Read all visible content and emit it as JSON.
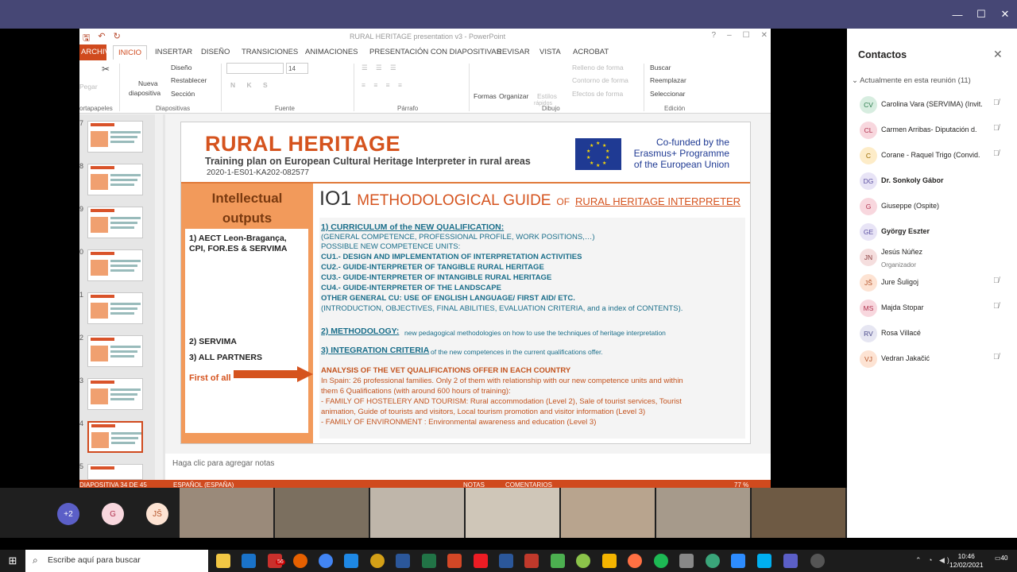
{
  "ppt": {
    "doc_title": "RURAL HERITAGE presentation v3 - PowerPoint",
    "tabs": [
      "ARCHIVO",
      "INICIO",
      "INSERTAR",
      "DISEÑO",
      "TRANSICIONES",
      "ANIMACIONES",
      "PRESENTACIÓN CON DIAPOSITIVAS",
      "REVISAR",
      "VISTA",
      "ACROBAT"
    ],
    "ribbon": {
      "pegar": "Pegar",
      "nueva": "Nueva",
      "diapositiva": "diapositiva",
      "diseno": "Diseño",
      "restablecer": "Restablecer",
      "seccion": "Sección",
      "font_size": "14",
      "formas": "Formas",
      "organizar": "Organizar",
      "estilos": "Estilos",
      "rapidos": "rápidos",
      "relleno": "Relleno de forma",
      "contorno": "Contorno de forma",
      "efectos": "Efectos de forma",
      "buscar": "Buscar",
      "reemplazar": "Reemplazar",
      "seleccionar": "Seleccionar",
      "groups": [
        "ortapapeles",
        "Diapositivas",
        "Fuente",
        "Párrafo",
        "Dibujo",
        "Edición"
      ]
    },
    "thumb_numbers": [
      "7",
      "8",
      "9",
      "0",
      "1",
      "2",
      "3",
      "4",
      "5"
    ],
    "notes_placeholder": "Haga clic para agregar notas",
    "status": {
      "slide": "DIAPOSITIVA 34 DE 45",
      "lang": "ESPAÑOL (ESPAÑA)",
      "notas": "NOTAS",
      "comentarios": "COMENTARIOS",
      "zoom": "77 %"
    }
  },
  "slide": {
    "title": "RURAL HERITAGE",
    "subtitle": "Training plan on European Cultural Heritage Interpreter in rural areas",
    "code": "2020-1-ES01-KA202-082577",
    "cofunded": [
      "Co-funded by the",
      "Erasmus+ Programme",
      "of the European Union"
    ],
    "left_header_1": "Intellectual",
    "left_header_2": "outputs",
    "left_item1a": "1)   AECT   Leon-Bragança,",
    "left_item1b": "CPI, FOR.ES & SERVIMA",
    "left_item2": "2) SERVIMA",
    "left_item3": "3) ALL PARTNERS",
    "first_of_all": "First of all",
    "io1": "IO1",
    "io1_guide": "METHODOLOGICAL GUIDE",
    "io1_of": "OF",
    "io1_rh": "RURAL HERITAGE INTERPRETER",
    "lines": {
      "l1": "1)   CURRICULUM of the NEW QUALIFICATION:",
      "l2": "(GENERAL COMPETENCE, PROFESSIONAL PROFILE, WORK POSITIONS,…)",
      "l3": "POSSIBLE NEW COMPETENCE UNITS:",
      "l4": "CU1.- DESIGN AND IMPLEMENTATION OF INTERPRETATION ACTIVITIES",
      "l5": "CU2.- GUIDE-INTERPRETER OF TANGIBLE RURAL HERITAGE",
      "l6": "CU3.- GUIDE-INTERPRETER OF INTANGIBLE RURAL HERITAGE",
      "l7": "CU4.- GUIDE-INTERPRETER OF THE LANDSCAPE",
      "l8": "OTHER GENERAL CU: USE OF ENGLISH LANGUAGE/ FIRST AID/ ETC.",
      "l9": "(INTRODUCTION, OBJECTIVES, FINAL ABILITIES, EVALUATION CRITERIA, and a index of CONTENTS).",
      "m1": "2) METHODOLOGY:",
      "m2": "new pedagogical methodologies on how to use the techniques of heritage interpretation",
      "i1": "3) INTEGRATION CRITERIA",
      "i2": "of the new competences in the current qualifications offer.",
      "a1": "ANALYSIS OF THE VET QUALIFICATIONS OFFER IN EACH COUNTRY",
      "a2": "In Spain: 26 professional families. Only 2 of them with relationship with our new competence units and within",
      "a3": "them 6 Qualifications (with around 600 hours of training):",
      "a4": "-     FAMILY OF HOSTELERY AND TOURISM: Rural accommodation (Level 2), Sale of tourist services, Tourist",
      "a5": "      animation, Guide of tourists and visitors, Local tourism promotion and visitor information (Level 3)",
      "a6": "-     FAMILY OF ENVIRONMENT : Environmental awareness and education (Level 3)"
    }
  },
  "participants": {
    "more": "+2",
    "g": "G",
    "js": "JŠ"
  },
  "contacts": {
    "title": "Contactos",
    "section": "Actualmente en esta reunión (11)",
    "people": [
      {
        "initials": "CV",
        "name": "Carolina Vara (SERVIMA) (Invit.",
        "color": "#d7ede0",
        "fg": "#2e7d4f",
        "muted": true,
        "bold": false
      },
      {
        "initials": "CL",
        "name": "Carmen Arribas- Diputación d.",
        "color": "#f8d7de",
        "fg": "#b0324e",
        "muted": true,
        "bold": false
      },
      {
        "initials": "C",
        "name": "Corane - Raquel Trigo (Convid.",
        "color": "#fdecc8",
        "fg": "#9a6a00",
        "muted": true,
        "bold": false
      },
      {
        "initials": "DG",
        "name": "Dr. Sonkoly Gábor",
        "color": "#e8e4f6",
        "fg": "#5b4fa0",
        "muted": false,
        "bold": true
      },
      {
        "initials": "G",
        "name": "Giuseppe (Ospite)",
        "color": "#f8d7de",
        "fg": "#b0324e",
        "muted": false,
        "bold": false
      },
      {
        "initials": "GE",
        "name": "György Eszter",
        "color": "#e8e4f6",
        "fg": "#5b4fa0",
        "muted": false,
        "bold": true
      },
      {
        "initials": "JN",
        "name": "Jesús Núñez",
        "role": "Organizador",
        "color": "#f5dede",
        "fg": "#8a3d3d",
        "muted": false,
        "bold": false
      },
      {
        "initials": "JŠ",
        "name": "Jure Šuligoj",
        "color": "#fde3d3",
        "fg": "#b5542a",
        "muted": true,
        "bold": false
      },
      {
        "initials": "MS",
        "name": "Majda Stopar",
        "color": "#f8d7de",
        "fg": "#b0324e",
        "muted": true,
        "bold": false
      },
      {
        "initials": "RV",
        "name": "Rosa Villacé",
        "color": "#e6e6f2",
        "fg": "#4a4a8a",
        "muted": false,
        "bold": false
      },
      {
        "initials": "VJ",
        "name": "Vedran Jakačić",
        "color": "#fde3d3",
        "fg": "#b5542a",
        "muted": true,
        "bold": false
      }
    ]
  },
  "taskbar": {
    "search_placeholder": "Escribe aquí para buscar",
    "time": "10:46",
    "date": "12/02/2021",
    "notif_count": "40",
    "badge": "56"
  }
}
